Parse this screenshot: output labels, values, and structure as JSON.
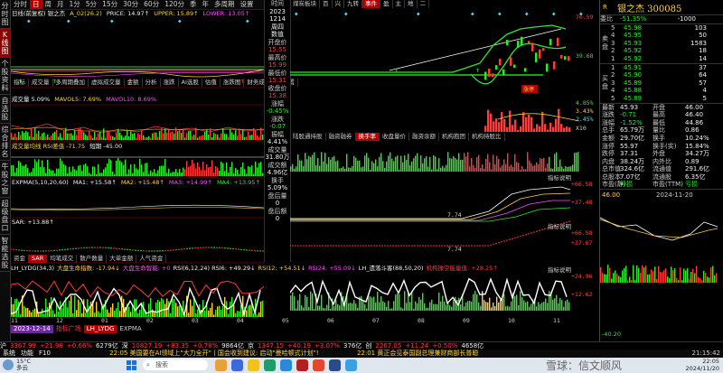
{
  "period_tabs": [
    "分时",
    "日",
    "周",
    "月",
    "1分",
    "5分",
    "15分",
    "30分",
    "60分",
    "120分",
    "季",
    "年",
    "多周期",
    "设置"
  ],
  "period_tab_active": "日",
  "left_tabs": [
    {
      "label": "分时图",
      "active": false
    },
    {
      "label": "K线图",
      "active": true
    },
    {
      "label": "个股资料",
      "active": false
    },
    {
      "label": "自选股",
      "active": false
    },
    {
      "label": "综合排名",
      "active": false
    },
    {
      "label": "牛股之窗",
      "active": false
    },
    {
      "label": "超级盘口",
      "active": false
    },
    {
      "label": "智能选股",
      "active": false
    }
  ],
  "main_header": {
    "name": "日线(前复权) 银之杰",
    "items": [
      "A_02(26.2)",
      "PRICE: 14.97↑",
      "UPPER: 15.89↑",
      "LOWER: 13.05↑"
    ]
  },
  "panel_tabs_1": [
    "指标",
    "成交量",
    "多周期叠加",
    "虚拟成交量",
    "金额",
    "分析",
    "涨跌",
    "AI选股",
    "估值",
    "涨跌图",
    "财务成交量",
    "设置"
  ],
  "vol_header": [
    "成交量 5.09%",
    "MAVOL5: 7.69%",
    "MAVOL10: 8.69%"
  ],
  "cap_header": [
    "成交量均线 RSI差值 -71.75",
    "短期 -45.00"
  ],
  "expma_header": [
    "EXPMA(5,10,20,60)",
    "MA1: +15.58↑",
    "MA2: +15.48↑",
    "MA3: +14.99↑",
    "MA4: +13.95↑"
  ],
  "sar_header": [
    "SAR: +13.88↑"
  ],
  "small_tabs": [
    "资金",
    "SAR",
    "均笔成交",
    "散户数量",
    "大单金额",
    "人气资金"
  ],
  "small_tabs_active": "SAR",
  "bottom_header": [
    "LH_LYDG(34,3)",
    "大盘生命指数: -17.94↓",
    "大盘生命智能: +0",
    "RSI(6,12,24) RSI6: +49.29↓",
    "RSI12: +54.51↓",
    "RSI24: +55.09↓",
    "LH_遗落斗客(88,50,20)",
    "机构操空能量值: +28.25↑"
  ],
  "bottom_tabs": [
    "指标广场",
    "LH_LYDG",
    "EXPMA"
  ],
  "bottom_tab_active": "LH_LYDG",
  "date_cursor": "2023-12-14",
  "x_month_labels": [
    "11",
    "12",
    "01",
    "02",
    "03",
    "04",
    "05",
    "06",
    "07",
    "08",
    "09",
    "10",
    "11"
  ],
  "info_col": [
    {
      "label": "时间",
      "value": "2023"
    },
    {
      "label": "",
      "value": "1214"
    },
    {
      "label": "",
      "value": "周四"
    },
    {
      "label": "",
      "value": "数值"
    },
    {
      "label": "开盘价",
      "value": "15.55"
    },
    {
      "label": "最高价",
      "value": "15.99"
    },
    {
      "label": "最低价",
      "value": "15.31"
    },
    {
      "label": "收盘价",
      "value": "15.38"
    },
    {
      "label": "涨幅",
      "value": "-0.45%"
    },
    {
      "label": "涨跌",
      "value": "-0.07"
    },
    {
      "label": "振幅",
      "value": "4.41%"
    },
    {
      "label": "成交量",
      "value": "31.80万"
    },
    {
      "label": "成交额",
      "value": "4.96亿"
    },
    {
      "label": "换手",
      "value": "5.09%"
    },
    {
      "label": "盘后量",
      "value": "0"
    },
    {
      "label": "盘后额",
      "value": "0"
    }
  ],
  "mid_panel": {
    "tabs_top": [
      "煤炭板块",
      "百",
      "兴",
      "九转",
      "事件",
      "盈",
      "主",
      "地",
      "二"
    ],
    "price_labels": [
      "70.59",
      "39.68",
      "4.85%",
      "3.43%",
      "2.45%"
    ],
    "tabs_mid": [
      "陆股通持股",
      "融资融券",
      "换手率",
      "收盘量价",
      "融资余额",
      "机构抱团",
      "机构持股比"
    ],
    "tabs_mid_active": "换手率",
    "label_zhaotou": "涨停",
    "label_zhibiao": "指标说明",
    "expma_vals": [
      "+66.58",
      "+37.48"
    ],
    "sar_vals": [
      "+66.58",
      "+37.67"
    ],
    "bottom_vals": [
      "+24.96",
      "+12.62"
    ],
    "low_label": "7.74",
    "x_label": "X10"
  },
  "quote": {
    "code": "R",
    "title": "银之杰 300085",
    "weibi_label": "委比",
    "weibi_value": "-51.35%",
    "weicha_value": "-1000",
    "sell": [
      {
        "n": "5",
        "p": "45.98",
        "v": "103"
      },
      {
        "n": "4",
        "p": "45.95",
        "v": "50"
      },
      {
        "n": "3",
        "p": "45.93",
        "v": "1583"
      },
      {
        "n": "2",
        "p": "45.92",
        "v": "18"
      },
      {
        "n": "1",
        "p": "45.92",
        "v": "14"
      }
    ],
    "sell_label": "卖盘",
    "buy_label": "买盘",
    "buy": [
      {
        "n": "1",
        "p": "45.91",
        "v": "37"
      },
      {
        "n": "2",
        "p": "45.90",
        "v": "64"
      },
      {
        "n": "3",
        "p": "45.89",
        "v": "57"
      },
      {
        "n": "4",
        "p": "45.88",
        "v": "4"
      },
      {
        "n": "5",
        "p": "45.89",
        "v": "5"
      }
    ],
    "stats": [
      [
        "最新",
        "45.93",
        "开盘",
        "46.00"
      ],
      [
        "涨跌",
        "-0.71",
        "最高",
        "46.40"
      ],
      [
        "涨幅",
        "-1.52%",
        "最低",
        "44.86"
      ],
      [
        "总手",
        "65.79万",
        "量比",
        "0.86"
      ],
      [
        "金额",
        "29.70亿",
        "换手",
        "10.24%"
      ],
      [
        "涨停",
        "55.97",
        "换手(实)",
        "15.84%"
      ],
      [
        "跌停",
        "37.31",
        "外盘",
        "34.27万"
      ],
      [
        "内盘",
        "38.24万",
        "内外比",
        "0.89"
      ],
      [
        "总市值",
        "324.6亿",
        "流通值",
        "291.6亿"
      ],
      [
        "总股本",
        "7.07亿",
        "流通股",
        "6.35亿"
      ],
      [
        "市盈(静)",
        "亏损",
        "市盈(TTM)",
        "亏损"
      ]
    ],
    "mini_vals": [
      "46.00",
      "2024-11-20"
    ],
    "mini_low": "-40.20"
  },
  "ticker": [
    {
      "t": "沪",
      "c": "wht"
    },
    {
      "t": "3367.99",
      "c": "red"
    },
    {
      "t": "+21.98",
      "c": "red"
    },
    {
      "t": "+0.66%",
      "c": "red"
    },
    {
      "t": "6279亿",
      "c": "wht"
    },
    {
      "t": "深",
      "c": "wht"
    },
    {
      "t": "10827.19",
      "c": "red"
    },
    {
      "t": "+83.35",
      "c": "red"
    },
    {
      "t": "+0.78%",
      "c": "red"
    },
    {
      "t": "9864亿",
      "c": "wht"
    },
    {
      "t": "京",
      "c": "wht"
    },
    {
      "t": "1347.15",
      "c": "red"
    },
    {
      "t": "+40.19",
      "c": "red"
    },
    {
      "t": "+3.07%",
      "c": "red"
    },
    {
      "t": "376亿",
      "c": "wht"
    },
    {
      "t": "创",
      "c": "wht"
    },
    {
      "t": "2267.05",
      "c": "red"
    },
    {
      "t": "+11.24",
      "c": "red"
    },
    {
      "t": "+0.50%",
      "c": "red"
    },
    {
      "t": "4658亿",
      "c": "wht"
    }
  ],
  "status_line": "22:05 美国要在AI领域上\"大力全开\"丨国会收到建议: 启动\"曼哈顿式计划\"!",
  "status_line2": "22:01 黄正会见泰国副总理兼财商部长普聪",
  "status_time": "21:15:42",
  "taskbar": {
    "weather_temp": "15°C",
    "weather_text": "多云",
    "search_placeholder": "搜索",
    "time": "22:05",
    "date": "2024/11/20",
    "watermark": "雪球：信文顺风"
  },
  "colors": {
    "red": "#ff3b3b",
    "green": "#2ee82e",
    "yellow": "#ffd23c",
    "bg": "#000000",
    "accent": "#b00000"
  }
}
